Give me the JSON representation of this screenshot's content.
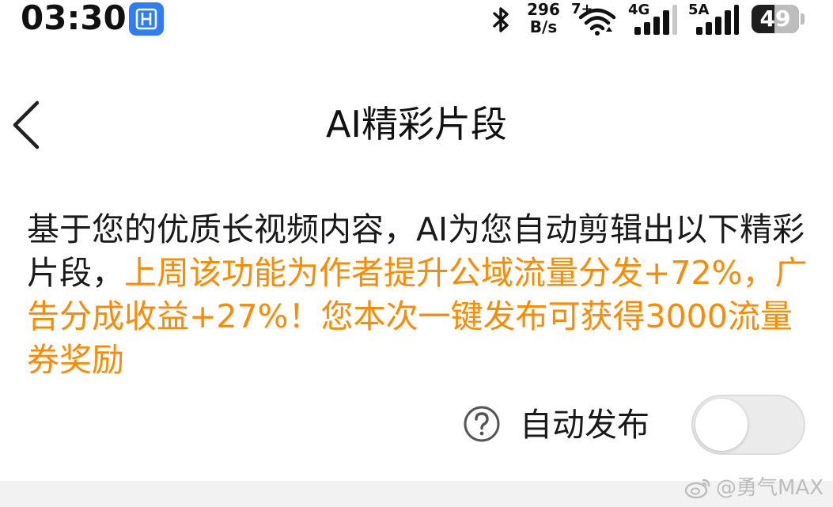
{
  "status_bar": {
    "time": "03:30",
    "net_speed_value": "296",
    "net_speed_unit": "B/s",
    "wifi_label": "7+",
    "signal1_label": "4G",
    "signal2_label": "5A",
    "battery_level": 49,
    "battery_text": "49"
  },
  "nav": {
    "title": "AI精彩片段"
  },
  "description": {
    "intro": "基于您的优质长视频内容，AI为您自动剪辑出以下精彩片段，",
    "highlight": "上周该功能为作者提升公域流量分发+72%，广告分成收益+27%！您本次一键发布可获得3000流量券奖励"
  },
  "auto_publish": {
    "label": "自动发布",
    "enabled": false
  },
  "watermark": {
    "text": "@勇气MAX"
  },
  "colors": {
    "highlight": "#ff8a00",
    "app_badge": "#2f7df6",
    "toggle_off": "#ebebeb"
  }
}
